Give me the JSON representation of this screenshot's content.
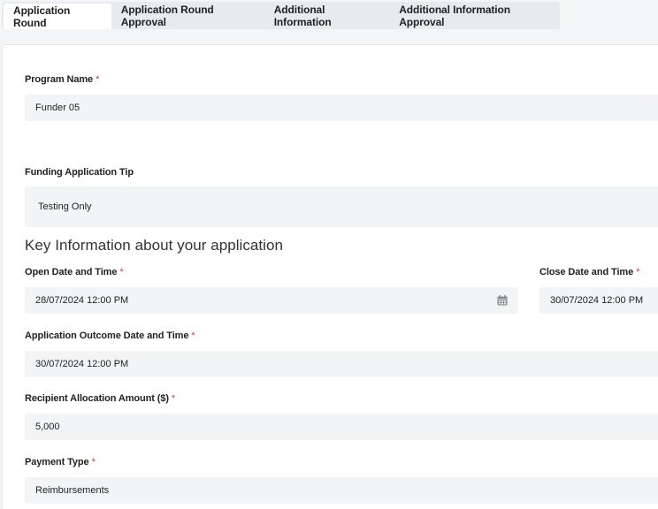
{
  "tabs": [
    {
      "label": "Application Round",
      "active": true
    },
    {
      "label": "Application Round Approval",
      "active": false
    },
    {
      "label": "Additional Information",
      "active": false
    },
    {
      "label": "Additional Information Approval",
      "active": false
    }
  ],
  "form": {
    "program_name": {
      "label": "Program Name",
      "required_mark": "*",
      "value": "Funder 05"
    },
    "funding_tip": {
      "label": "Funding Application Tip",
      "value": "Testing Only"
    },
    "key_info_title": "Key Information about your application",
    "open_date": {
      "label": "Open Date and Time",
      "required_mark": "*",
      "value": "28/07/2024 12:00 PM",
      "icon": "calendar-icon"
    },
    "close_date": {
      "label": "Close Date and Time",
      "required_mark": "*",
      "value": "30/07/2024 12:00 PM"
    },
    "outcome_date": {
      "label": "Application Outcome Date and Time",
      "required_mark": "*",
      "value": "30/07/2024 12:00 PM"
    },
    "allocation_amount": {
      "label": "Recipient Allocation Amount ($)",
      "required_mark": "*",
      "value": "5,000"
    },
    "payment_type": {
      "label": "Payment Type",
      "required_mark": "*",
      "value": "Reimbursements"
    }
  },
  "colors": {
    "required": "#d9372b",
    "field_bg": "#f3f4f6",
    "tab_bar_bg": "#e9eaed"
  }
}
